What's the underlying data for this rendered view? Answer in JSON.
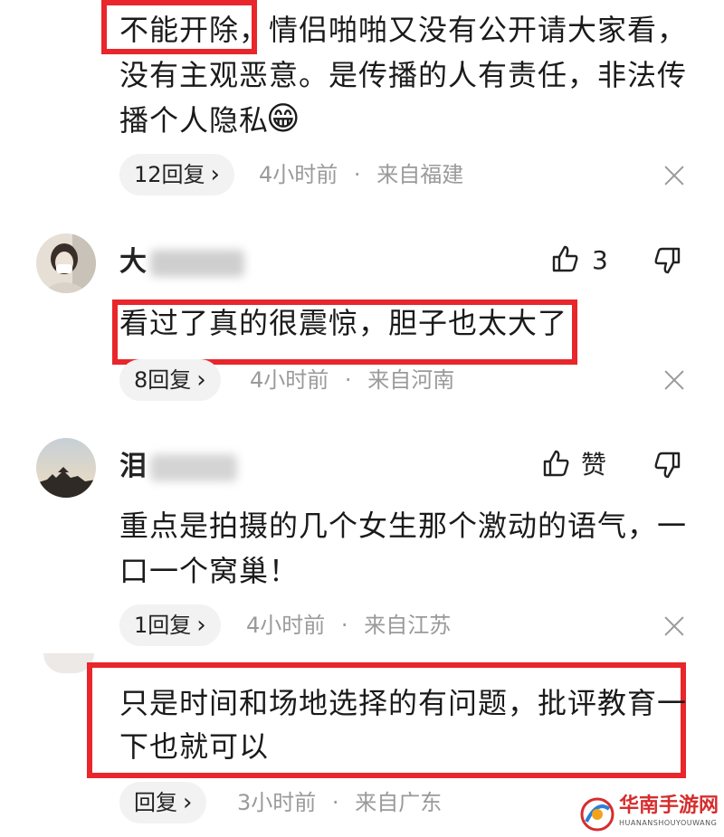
{
  "comments": [
    {
      "lines": [
        "不能开除，情侣啪啪又没有公开请大家看，",
        "没有主观恶意。是传播的人有责任，非法传",
        "播个人隐私"
      ],
      "emoji": "😁",
      "replies": "12回复",
      "time": "4小时前",
      "location": "来自福建"
    },
    {
      "username": "大",
      "likes": "3",
      "lines": [
        "看过了真的很震惊，胆子也太大了"
      ],
      "replies": "8回复",
      "time": "4小时前",
      "location": "来自河南"
    },
    {
      "username": "泪",
      "likes": "赞",
      "lines": [
        "重点是拍摄的几个女生那个激动的语气，一",
        "口一个窝巢！"
      ],
      "replies": "1回复",
      "time": "4小时前",
      "location": "来自江苏"
    },
    {
      "lines": [
        "只是时间和场地选择的有问题，批评教育一",
        "下也就可以"
      ],
      "replies": "回复",
      "time": "3小时前",
      "location": "来自广东"
    }
  ],
  "separator": "·",
  "chevron": "›",
  "watermark": {
    "title": "华南手游网",
    "subtitle": "HUANANSHOUYOUWANG"
  },
  "colors": {
    "highlight": "#e8262b",
    "meta_gray": "#9a9a9a",
    "pill_bg": "#f2f2f2",
    "watermark_red": "#d62d2d"
  },
  "icons": [
    "thumbs-up-icon",
    "thumbs-down-icon",
    "close-icon",
    "chevron-right-icon",
    "grin-emoji"
  ]
}
